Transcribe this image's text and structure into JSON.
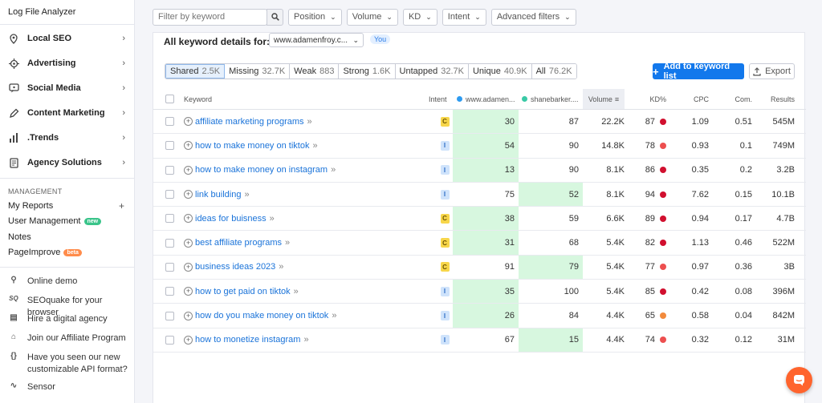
{
  "sidebar": {
    "top_item": "Log File Analyzer",
    "nav": [
      {
        "label": "Local SEO",
        "icon": "location-pin-icon"
      },
      {
        "label": "Advertising",
        "icon": "target-icon"
      },
      {
        "label": "Social Media",
        "icon": "social-icon"
      },
      {
        "label": "Content Marketing",
        "icon": "pencil-icon"
      },
      {
        "label": ".Trends",
        "icon": "bar-chart-icon"
      },
      {
        "label": "Agency Solutions",
        "icon": "document-icon"
      }
    ],
    "management_title": "MANAGEMENT",
    "management": [
      {
        "label": "My Reports",
        "badge": ""
      },
      {
        "label": "User Management",
        "badge": "new"
      },
      {
        "label": "Notes",
        "badge": ""
      },
      {
        "label": "PageImprove",
        "badge": "beta"
      }
    ],
    "resources": [
      {
        "label": "Online demo",
        "icon": "demo-icon"
      },
      {
        "label": "SEOquake for your browser",
        "icon": "seoquake-icon"
      },
      {
        "label": "Hire a digital agency",
        "icon": "agency-icon"
      },
      {
        "label": "Join our Affiliate Program",
        "icon": "affiliate-icon"
      },
      {
        "label": "Have you seen our new customizable API format?",
        "icon": "api-icon"
      },
      {
        "label": "Sensor",
        "icon": "sensor-icon"
      }
    ]
  },
  "filters": {
    "search_placeholder": "Filter by keyword",
    "dropdowns": [
      "Position",
      "Volume",
      "KD",
      "Intent",
      "Advanced filters"
    ]
  },
  "details": {
    "title": "All keyword details for:",
    "domain": "www.adamenfroy.c...",
    "you_badge": "You"
  },
  "segments": [
    {
      "label": "Shared",
      "count": "2.5K",
      "active": true
    },
    {
      "label": "Missing",
      "count": "32.7K"
    },
    {
      "label": "Weak",
      "count": "883"
    },
    {
      "label": "Strong",
      "count": "1.6K"
    },
    {
      "label": "Untapped",
      "count": "32.7K"
    },
    {
      "label": "Unique",
      "count": "40.9K"
    },
    {
      "label": "All",
      "count": "76.2K"
    }
  ],
  "buttons": {
    "add": "Add to keyword list",
    "export": "Export"
  },
  "table": {
    "headers": {
      "keyword": "Keyword",
      "intent": "Intent",
      "domain1": "www.adamen...",
      "domain2": "shanebarker....",
      "volume": "Volume",
      "kd": "KD%",
      "cpc": "CPC",
      "com": "Com.",
      "results": "Results"
    },
    "colors": {
      "domain1": "#2e9bf0",
      "domain2": "#39c9a6",
      "kd_red": "#d1102f",
      "kd_lightred": "#ed4f4f",
      "kd_orange": "#f28a3c",
      "highlight": "#d7f7df"
    },
    "rows": [
      {
        "keyword": "affiliate marketing programs",
        "intent": "C",
        "p1": "30",
        "p2": "87",
        "win": 1,
        "volume": "22.2K",
        "kd": "87",
        "kd_color": "#d1102f",
        "cpc": "1.09",
        "com": "0.51",
        "results": "545M"
      },
      {
        "keyword": "how to make money on tiktok",
        "intent": "I",
        "p1": "54",
        "p2": "90",
        "win": 1,
        "volume": "14.8K",
        "kd": "78",
        "kd_color": "#ed4f4f",
        "cpc": "0.93",
        "com": "0.1",
        "results": "749M"
      },
      {
        "keyword": "how to make money on instagram",
        "intent": "I",
        "p1": "13",
        "p2": "90",
        "win": 1,
        "volume": "8.1K",
        "kd": "86",
        "kd_color": "#d1102f",
        "cpc": "0.35",
        "com": "0.2",
        "results": "3.2B"
      },
      {
        "keyword": "link building",
        "intent": "I",
        "p1": "75",
        "p2": "52",
        "win": 2,
        "volume": "8.1K",
        "kd": "94",
        "kd_color": "#d1102f",
        "cpc": "7.62",
        "com": "0.15",
        "results": "10.1B"
      },
      {
        "keyword": "ideas for buisness",
        "intent": "C",
        "p1": "38",
        "p2": "59",
        "win": 1,
        "volume": "6.6K",
        "kd": "89",
        "kd_color": "#d1102f",
        "cpc": "0.94",
        "com": "0.17",
        "results": "4.7B"
      },
      {
        "keyword": "best affiliate programs",
        "intent": "C",
        "p1": "31",
        "p2": "68",
        "win": 1,
        "volume": "5.4K",
        "kd": "82",
        "kd_color": "#d1102f",
        "cpc": "1.13",
        "com": "0.46",
        "results": "522M"
      },
      {
        "keyword": "business ideas 2023",
        "intent": "C",
        "p1": "91",
        "p2": "79",
        "win": 2,
        "volume": "5.4K",
        "kd": "77",
        "kd_color": "#ed4f4f",
        "cpc": "0.97",
        "com": "0.36",
        "results": "3B"
      },
      {
        "keyword": "how to get paid on tiktok",
        "intent": "I",
        "p1": "35",
        "p2": "100",
        "win": 1,
        "volume": "5.4K",
        "kd": "85",
        "kd_color": "#d1102f",
        "cpc": "0.42",
        "com": "0.08",
        "results": "396M"
      },
      {
        "keyword": "how do you make money on tiktok",
        "intent": "I",
        "p1": "26",
        "p2": "84",
        "win": 1,
        "volume": "4.4K",
        "kd": "65",
        "kd_color": "#f28a3c",
        "cpc": "0.58",
        "com": "0.04",
        "results": "842M"
      },
      {
        "keyword": "how to monetize instagram",
        "intent": "I",
        "p1": "67",
        "p2": "15",
        "win": 2,
        "volume": "4.4K",
        "kd": "74",
        "kd_color": "#ed4f4f",
        "cpc": "0.32",
        "com": "0.12",
        "results": "31M"
      }
    ]
  }
}
